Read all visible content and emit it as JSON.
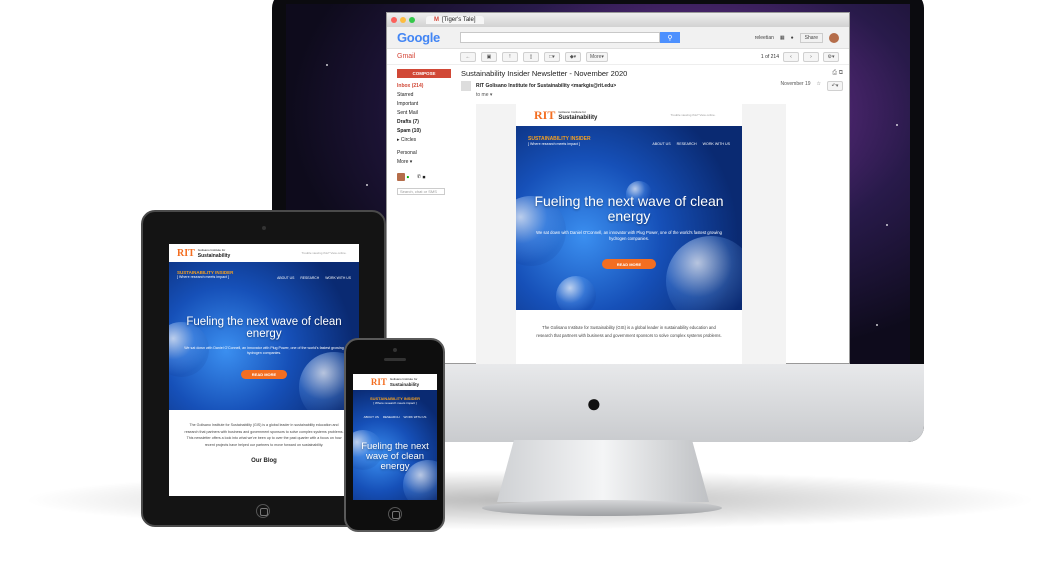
{
  "browser": {
    "tab_title": "[Tiger's Tale]",
    "gmail_glyph": "M"
  },
  "gmail": {
    "logo": "Google",
    "label": "Gmail",
    "search_icon": "search-icon",
    "user": "releetian",
    "share": "Share",
    "more": "More",
    "pager": "1 of 214",
    "compose": "COMPOSE",
    "folders": [
      "Inbox (214)",
      "Starred",
      "Important",
      "Sent Mail",
      "Drafts (7)",
      "Spam (10)",
      "Circles",
      "Personal",
      "More"
    ],
    "chat_search": "Search, chat or SMS",
    "subject": "Sustainability Insider Newsletter - November 2020",
    "sender": "RIT Golisano Institute for Sustainability <markgis@rit.edu>",
    "date": "November 19",
    "to": "to me"
  },
  "newsletter": {
    "brand_rit": "RIT",
    "brand_small": "Golisano Institute for",
    "brand_name": "Sustainability",
    "view_online": "Trouble viewing this? View online.",
    "section": "SUSTAINABILITY INSIDER",
    "tagline": "[ Where research meets impact ]",
    "nav": [
      "ABOUT US",
      "RESEARCH",
      "WORK WITH US"
    ],
    "headline": "Fueling the next wave of clean energy",
    "sub": "We sat down with Daniel O'Connell, an innovator with Plug Power, one of the world's fastest growing hydrogen companies.",
    "cta": "READ MORE",
    "body": "The Golisano Institute for Sustainability (GIS) is a global leader in sustainability education and research that partners with business and government sponsors to solve complex systems problems.",
    "ipad_body": "The Golisano Institute for Sustainability (GIS) is a global leader in sustainability education and research that partners with business and government sponsors to solve complex systems problems. This newsletter offers a look into what we've been up to over the past quarter with a focus on how recent projects have helped our partners to move forward on sustainability.",
    "blog": "Our Blog"
  }
}
